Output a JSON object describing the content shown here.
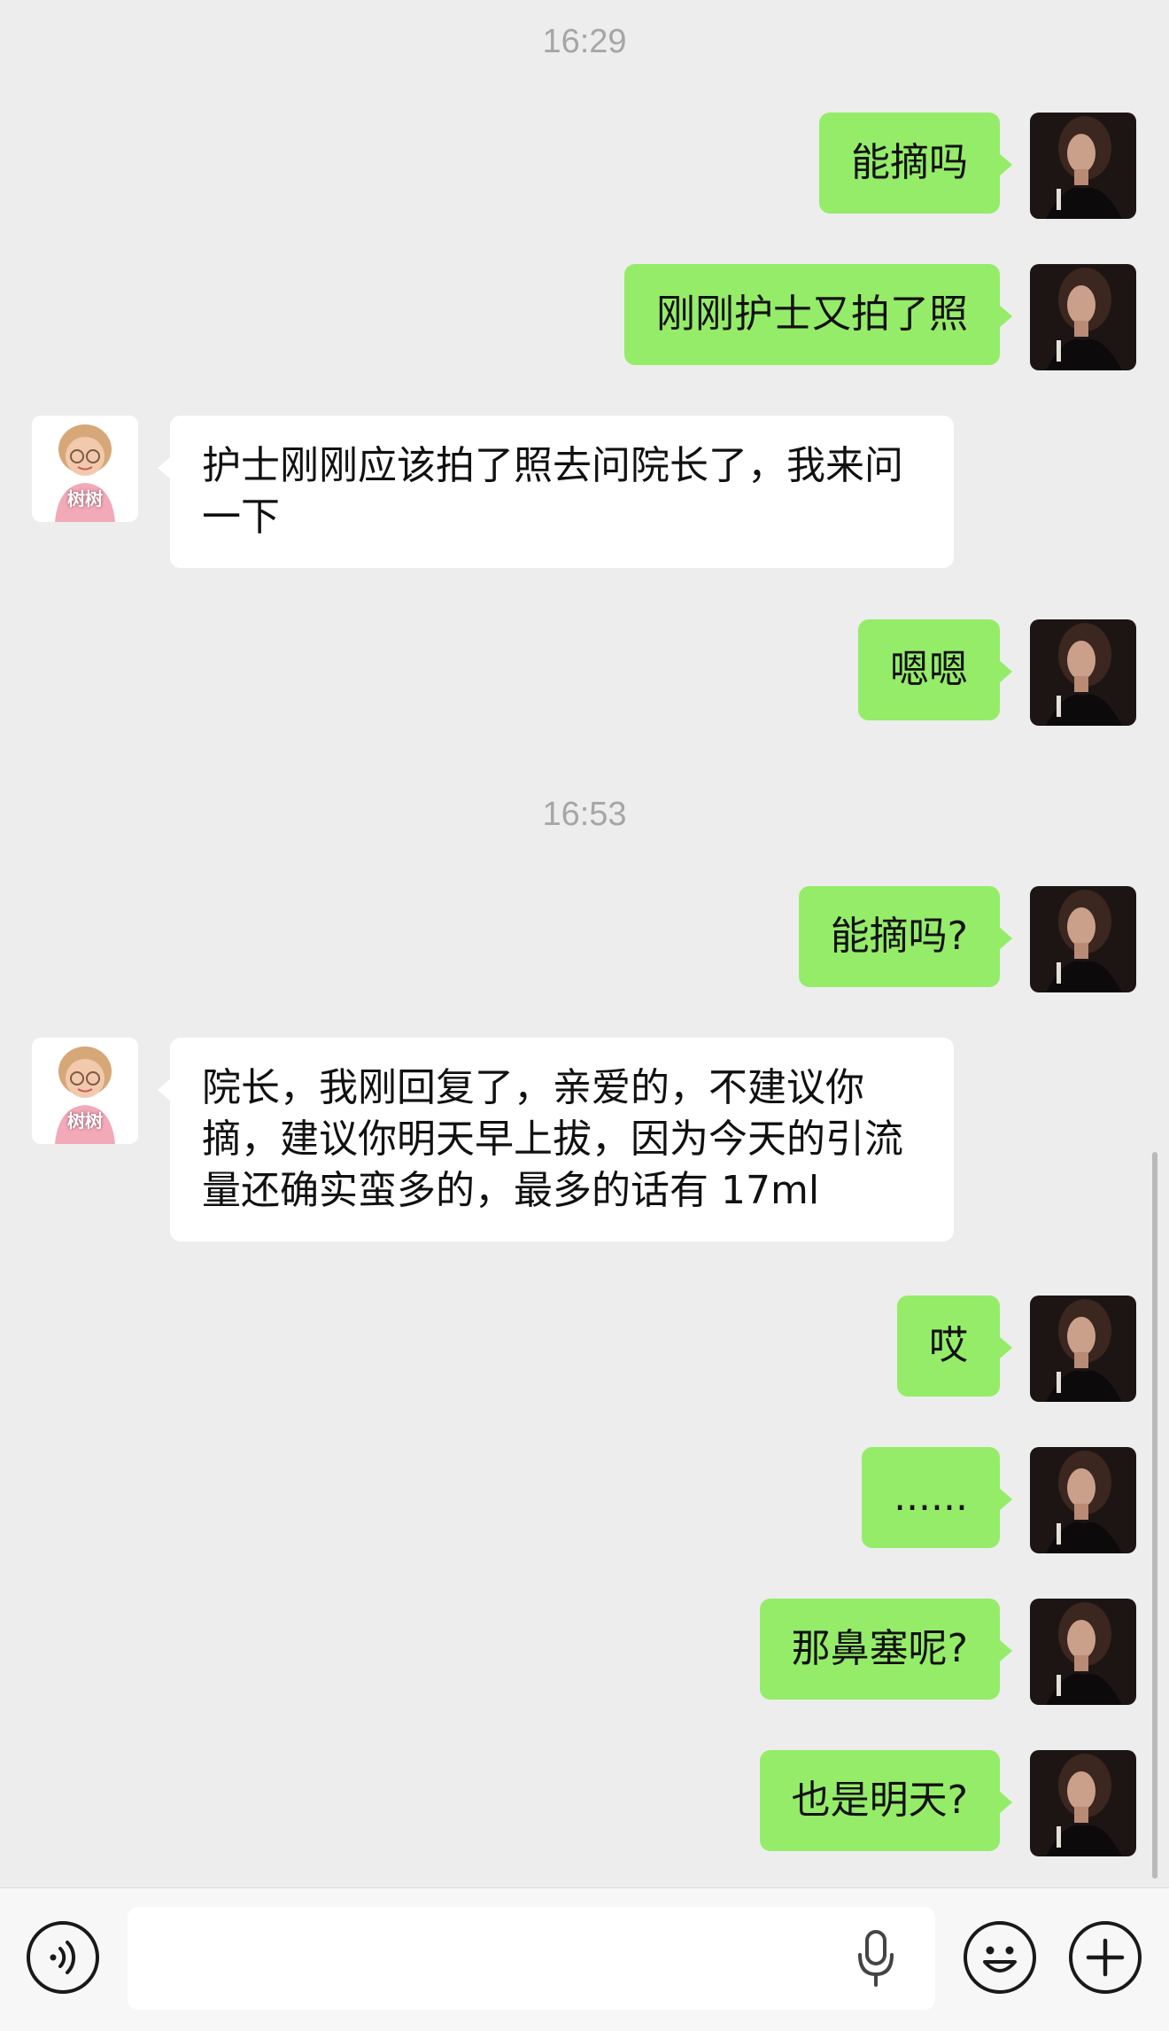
{
  "messages": {
    "time1": "16:29",
    "m1": "能摘吗",
    "m2": "刚刚护士又拍了照",
    "m3": "护士刚刚应该拍了照去问院长了，我来问一下",
    "m4": "嗯嗯",
    "time2": "16:53",
    "m5": "能摘吗?",
    "m6": "院长，我刚回复了，亲爱的，不建议你摘，建议你明天早上拔，因为今天的引流量还确实蛮多的，最多的话有 17ml",
    "m7": "哎",
    "m8": "......",
    "m9": "那鼻塞呢?",
    "m10": "也是明天?"
  },
  "contact": {
    "avatar_label": "树树"
  },
  "input_bar": {
    "icons": [
      "voice-toggle-icon",
      "microphone-icon",
      "emoji-icon",
      "plus-icon"
    ]
  },
  "colors": {
    "background": "#ededed",
    "my_bubble": "#95ec69",
    "their_bubble": "#ffffff",
    "timestamp": "#a6a6a6"
  }
}
